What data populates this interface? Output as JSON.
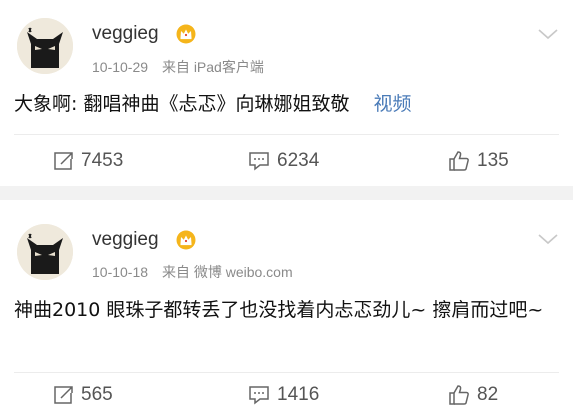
{
  "posts": [
    {
      "username": "veggieg",
      "date": "10-10-29",
      "source": "来自 iPad客户端",
      "content": "大象啊: 翻唱神曲《忐忑》向琳娜姐致敬",
      "video_link": "视频",
      "reposts": "7453",
      "comments": "6234",
      "likes": "135"
    },
    {
      "username": "veggieg",
      "date": "10-10-18",
      "source": "来自 微博 weibo.com",
      "content": "神曲2010 眼珠子都转丢了也没找着内忐忑劲儿~ 擦肩而过吧~",
      "reposts": "565",
      "comments": "1416",
      "likes": "82"
    }
  ],
  "icons": {
    "avatar": "black-cat-avatar-icon",
    "badge": "crown-badge-icon",
    "menu": "chevron-down-icon",
    "repost": "repost-icon",
    "comment": "comment-icon",
    "like": "thumbs-up-icon"
  },
  "colors": {
    "link": "#4a7bb8",
    "separator": "#f2f2f2",
    "crown": "#f5b51b"
  }
}
